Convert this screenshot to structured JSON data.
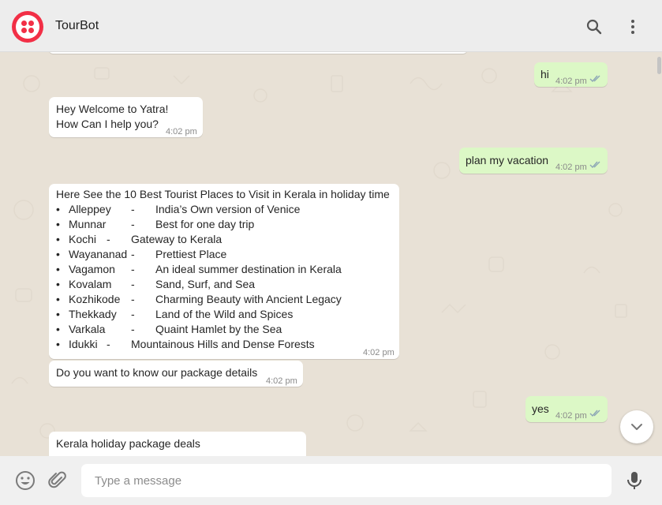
{
  "header": {
    "title": "TourBot",
    "icons": [
      "twilio-logo",
      "search-icon",
      "menu-icon"
    ]
  },
  "colors": {
    "brand_red": "#f22f46",
    "incoming_bubble": "#ffffff",
    "outgoing_bubble": "#dcf8c6",
    "chat_background": "#e8e1d6",
    "read_ticks": "#8ca6b5"
  },
  "messages": {
    "m1": {
      "text": "hi",
      "time": "4:02 pm"
    },
    "m2": {
      "line1": "Hey Welcome to Yatra!",
      "line2": "How Can I help you?",
      "time": "4:02 pm"
    },
    "m3": {
      "text": "plan my vacation",
      "time": "4:02 pm"
    },
    "m4": {
      "heading": "Here See the 10 Best Tourist Places to Visit in Kerala in holiday time",
      "items": [
        {
          "bullet": "•",
          "place": "Alleppey",
          "dash": "-",
          "desc": "India’s Own version of Venice"
        },
        {
          "bullet": "•",
          "place": "Munnar",
          "dash": "-",
          "desc": "Best for one day trip"
        },
        {
          "bullet": "•",
          "place": "Kochi",
          "dash": "-",
          "desc": "Gateway to Kerala"
        },
        {
          "bullet": "•",
          "place": "Wayananad",
          "dash": "-",
          "desc": "Prettiest Place"
        },
        {
          "bullet": "•",
          "place": "Vagamon",
          "dash": "-",
          "desc": "An ideal summer destination in Kerala"
        },
        {
          "bullet": "•",
          "place": "Kovalam",
          "dash": "-",
          "desc": "Sand, Surf, and Sea"
        },
        {
          "bullet": "•",
          "place": "Kozhikode",
          "dash": "-",
          "desc": "Charming Beauty with Ancient Legacy"
        },
        {
          "bullet": "•",
          "place": "Thekkady",
          "dash": "-",
          "desc": "Land of the Wild and Spices"
        },
        {
          "bullet": "•",
          "place": "Varkala",
          "dash": "-",
          "desc": "Quaint Hamlet by the Sea"
        },
        {
          "bullet": "•",
          "place": "Idukki",
          "dash": "-",
          "desc": "Mountainous Hills and Dense Forests"
        }
      ],
      "time": "4:02 pm"
    },
    "m5": {
      "text": "Do you want to know our package details",
      "time": "4:02 pm"
    },
    "m6": {
      "text": "yes",
      "time": "4:02 pm"
    },
    "m7": {
      "heading": "Kerala holiday package deals"
    }
  },
  "footer": {
    "placeholder": "Type a message",
    "icons": [
      "emoji-icon",
      "attach-icon",
      "mic-icon"
    ]
  }
}
